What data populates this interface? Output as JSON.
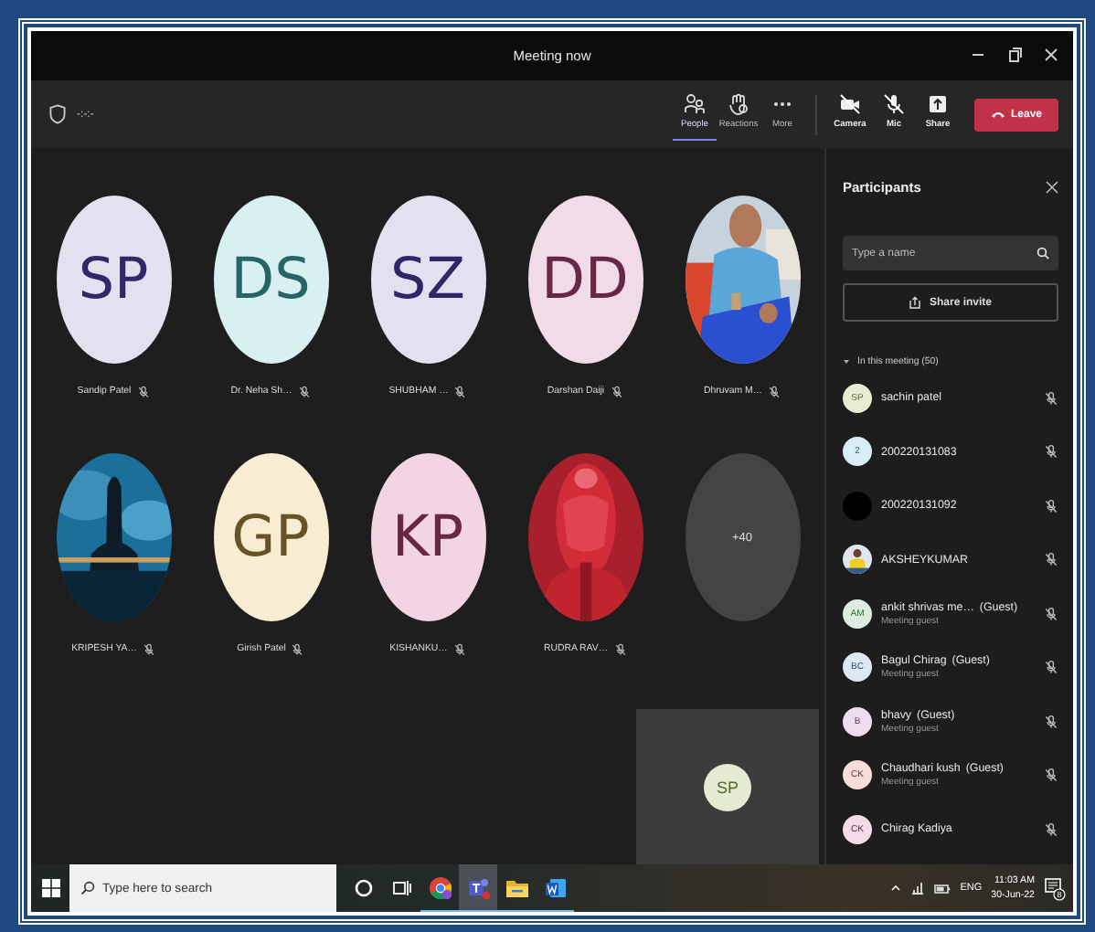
{
  "window": {
    "title": "Meeting now"
  },
  "toolbar": {
    "timer": "-:-:-",
    "view_buttons": [
      {
        "kind": "people",
        "label": "People",
        "selected": true
      },
      {
        "kind": "reactions",
        "label": "Reactions",
        "selected": false
      },
      {
        "kind": "more",
        "label": "More",
        "selected": false
      }
    ],
    "device_buttons": [
      {
        "kind": "camera",
        "label": "Camera",
        "off": true
      },
      {
        "kind": "mic",
        "label": "Mic",
        "off": true
      },
      {
        "kind": "share",
        "label": "Share"
      }
    ],
    "leave": "Leave"
  },
  "stage": {
    "tiles": [
      {
        "kind": "initials",
        "initials": "SP",
        "color": "#e3e0f0",
        "name": "Sandip Patel",
        "muted": true
      },
      {
        "kind": "initials",
        "initials": "DS",
        "color": "#d9f0f1",
        "name": "Dr. Neha Sh…",
        "muted": true
      },
      {
        "kind": "initials",
        "initials": "SZ",
        "color": "#e3e1f0",
        "name": "SHUBHAM …",
        "muted": true
      },
      {
        "kind": "initials",
        "initials": "DD",
        "color": "#f0dbe6",
        "name": "Darshan Daiji",
        "muted": true
      },
      {
        "kind": "picture",
        "name": "Dhruvam M…",
        "muted": true
      },
      {
        "kind": "picture",
        "name": "KRIPESH YA…",
        "muted": true
      },
      {
        "kind": "initials",
        "initials": "GP",
        "color": "#f8ecd2",
        "name": "Girish Patel",
        "muted": true
      },
      {
        "kind": "initials",
        "initials": "KP",
        "color": "#f2d4e2",
        "name": "KISHANKU…",
        "muted": true
      },
      {
        "kind": "picture",
        "name": "RUDRA RAV…",
        "muted": true
      },
      {
        "kind": "overflow",
        "label": "+40"
      }
    ],
    "self_view": {
      "initials": "SP",
      "color": "#e4ebd2"
    }
  },
  "panel": {
    "title": "Participants",
    "search": {
      "placeholder": "Type a name"
    },
    "share_button": "Share invite",
    "section": {
      "label": "In this meeting (50)",
      "expanded": true
    },
    "participants": [
      {
        "kind": "initials",
        "initials": "SP",
        "color": "#e8ecd0",
        "name": "sachin patel",
        "muted": true
      },
      {
        "kind": "initials",
        "initials": "2",
        "color": "#d8eef4",
        "name": "200220131083",
        "muted": true
      },
      {
        "kind": "blank",
        "color": "#000000",
        "name": "200220131092",
        "muted": true
      },
      {
        "kind": "picture",
        "name": "AKSHEYKUMAR",
        "muted": true
      },
      {
        "kind": "initials",
        "initials": "AM",
        "color": "#e0ebe0",
        "name": "ankit shrivas me…",
        "guest_tag": "(Guest)",
        "subtitle": "Meeting guest",
        "muted": true
      },
      {
        "kind": "initials",
        "initials": "BC",
        "color": "#dde8f2",
        "name": "Bagul Chirag",
        "guest_tag": "(Guest)",
        "subtitle": "Meeting guest",
        "muted": true
      },
      {
        "kind": "initials",
        "initials": "B",
        "color": "#f0dcef",
        "name": "bhavy",
        "guest_tag": "(Guest)",
        "subtitle": "Meeting guest",
        "muted": true
      },
      {
        "kind": "initials",
        "initials": "CK",
        "color": "#f8dcd6",
        "name": "Chaudhari kush",
        "guest_tag": "(Guest)",
        "subtitle": "Meeting guest",
        "muted": true
      },
      {
        "kind": "initials",
        "initials": "CK",
        "color": "#f4dbe8",
        "name": "Chirag Kadiya",
        "muted": true
      }
    ]
  },
  "taskbar": {
    "search": {
      "placeholder": "Type here to search"
    },
    "apps": [
      {
        "kind": "cortana",
        "running": false,
        "selected": false
      },
      {
        "kind": "taskview",
        "running": false,
        "selected": false
      },
      {
        "kind": "chrome",
        "running": true,
        "selected": false
      },
      {
        "kind": "teams",
        "running": true,
        "selected": true
      },
      {
        "kind": "explorer",
        "running": true,
        "selected": false
      },
      {
        "kind": "word",
        "running": true,
        "selected": false
      }
    ],
    "tray": {
      "language": "ENG",
      "time": "11:03 AM",
      "date": "30-Jun-22",
      "notifications": "8"
    }
  }
}
